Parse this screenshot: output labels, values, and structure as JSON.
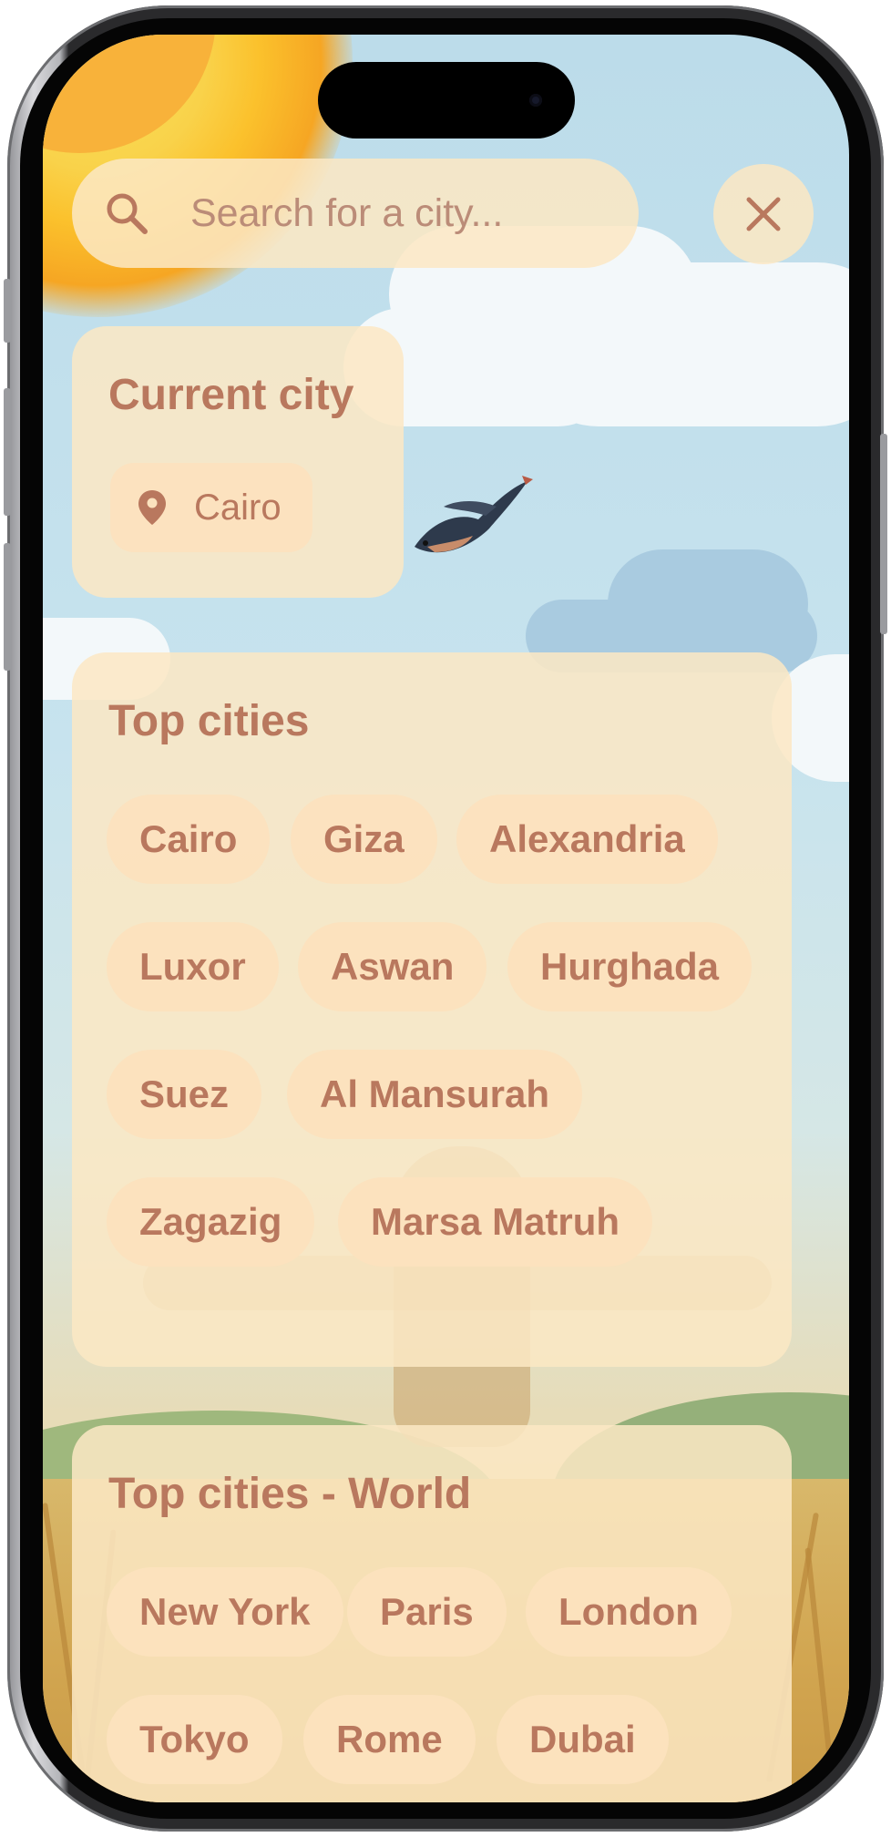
{
  "search": {
    "placeholder": "Search for a city..."
  },
  "current_city": {
    "title": "Current city",
    "city": "Cairo"
  },
  "top_cities": {
    "title": "Top cities",
    "cities": [
      "Cairo",
      "Giza",
      "Alexandria",
      "Luxor",
      "Aswan",
      "Hurghada",
      "Suez",
      "Al Mansurah",
      "Zagazig",
      "Marsa Matruh"
    ]
  },
  "top_cities_world": {
    "title": "Top cities - World",
    "cities": [
      "New York",
      "Paris",
      "London",
      "Tokyo",
      "Rome",
      "Dubai"
    ]
  },
  "icons": {
    "search": "search-icon",
    "close": "close-icon",
    "location": "location-pin-icon"
  },
  "colors": {
    "text_accent": "#b9785e",
    "panel": "#fbe8c4",
    "sky": "#c7e3ee",
    "sun": "#f8b23a"
  }
}
